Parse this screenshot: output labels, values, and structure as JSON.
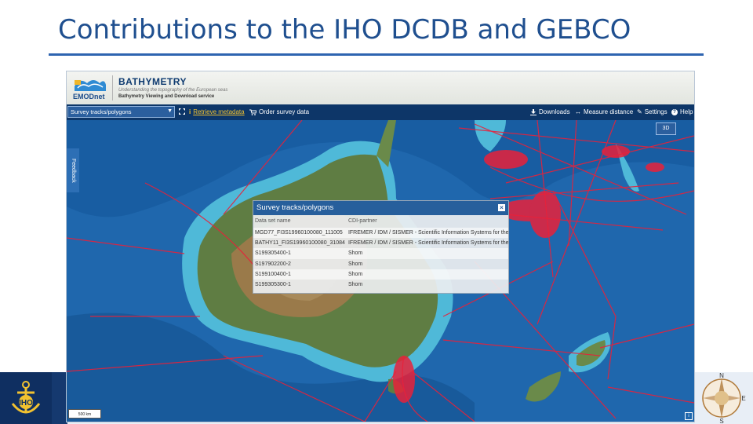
{
  "slide": {
    "title": "Contributions to the IHO DCDB and GEBCO"
  },
  "app": {
    "brand": "EMODnet",
    "title": "BATHYMETRY",
    "subtitle": "Understanding the topography of the European seas",
    "service": "Bathymetry Viewing and Download service"
  },
  "toolbar": {
    "layer_select": "Survey tracks/polygons",
    "retrieve": "Retrieve metadata",
    "order": "Order survey data",
    "downloads": "Downloads",
    "measure": "Measure distance",
    "settings": "Settings",
    "help": "Help"
  },
  "map": {
    "feedback": "Feedback",
    "btn_3d": "3D",
    "scale": "500 km",
    "info": "i"
  },
  "popup": {
    "title": "Survey tracks/polygons",
    "close": "×",
    "columns": [
      "Data set name",
      "CDI-partner"
    ],
    "rows": [
      [
        "MGD77_FI3S19960100080_111005",
        "IFREMER / IDM / SISMER - Scientific Information Systems for the SEA"
      ],
      [
        "BATHY11_FI3S19960100080_31084",
        "IFREMER / IDM / SISMER - Scientific Information Systems for the SEA"
      ],
      [
        "S199305400-1",
        "Shom"
      ],
      [
        "S197902200-2",
        "Shom"
      ],
      [
        "S199100400-1",
        "Shom"
      ],
      [
        "S199305300-1",
        "Shom"
      ]
    ]
  },
  "colors": {
    "title": "#1f4f8f",
    "rule": "#2e64b0",
    "toolbar": "#0d3668",
    "ocean": "#1e63a8",
    "tracks": "#e8213a"
  }
}
